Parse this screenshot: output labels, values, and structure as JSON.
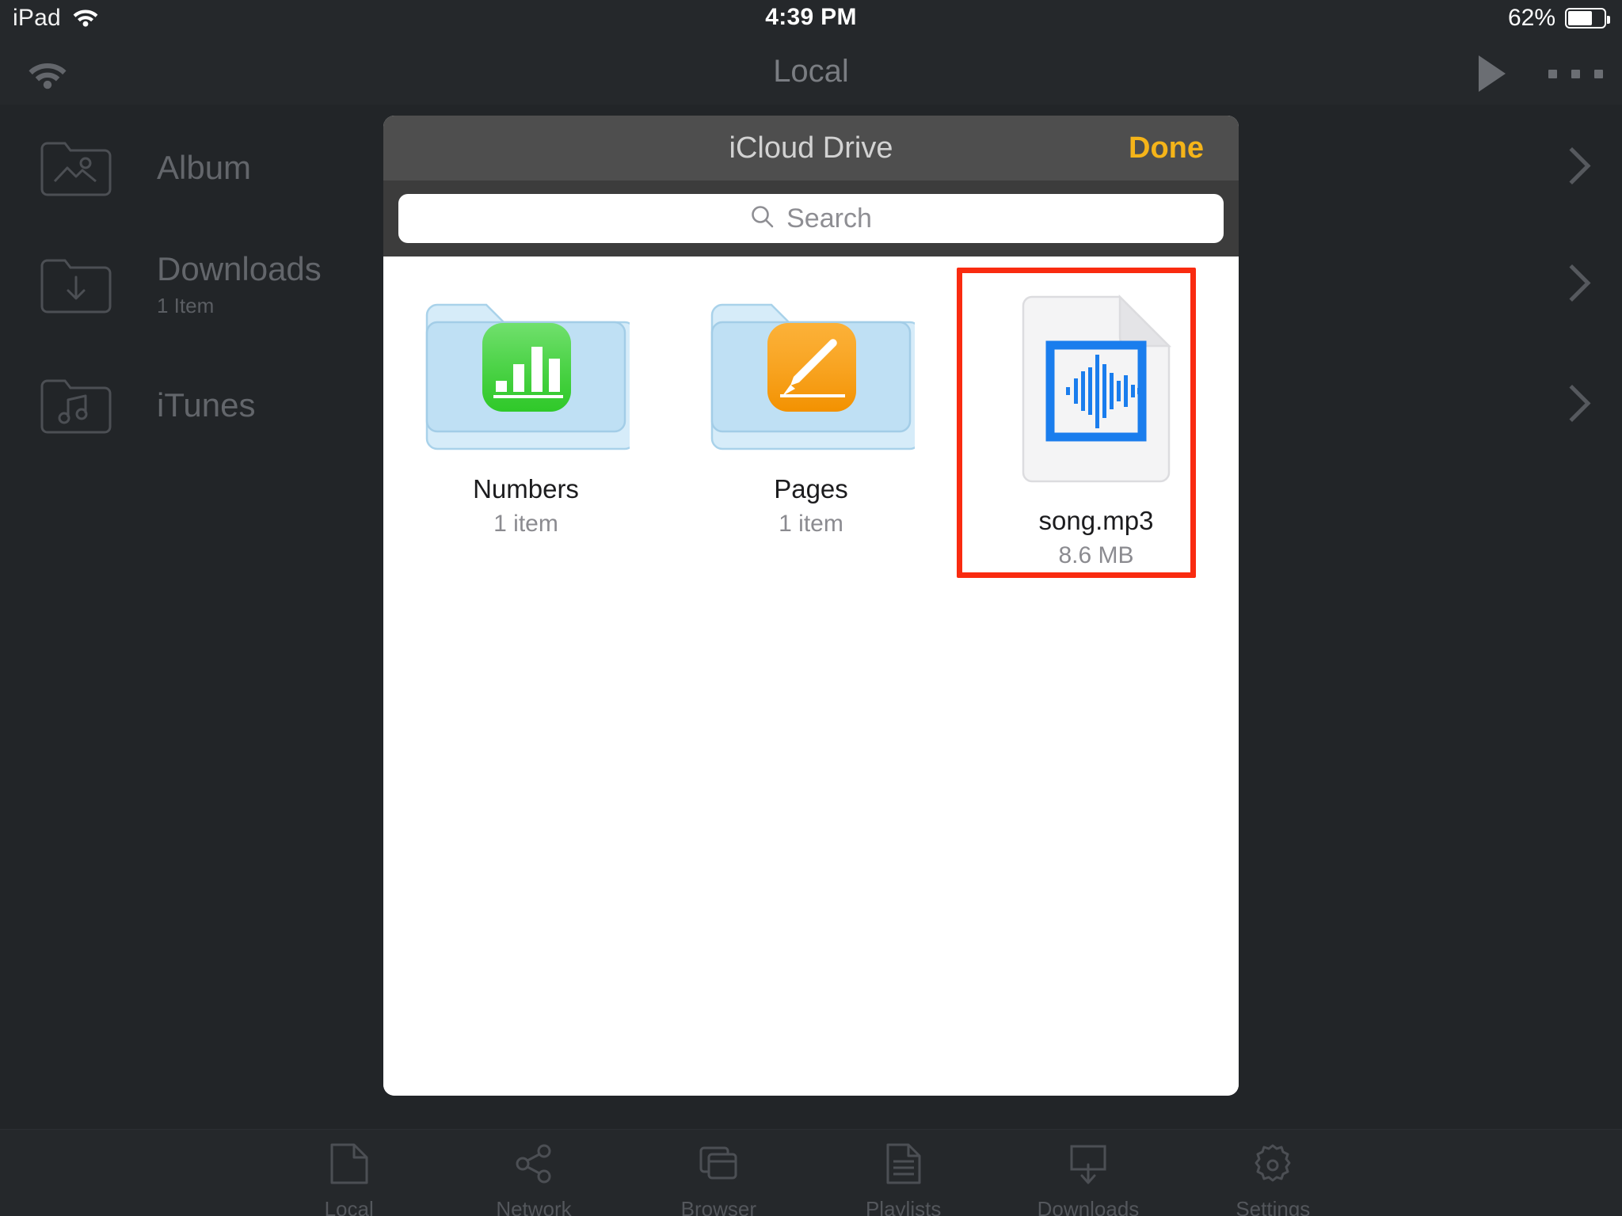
{
  "status_bar": {
    "device": "iPad",
    "wifi_icon": "wifi-icon",
    "time": "4:39 PM",
    "battery_percent": "62%",
    "battery_level": 62
  },
  "nav_bar": {
    "title": "Local",
    "wifi_icon": "wifi-icon",
    "play_icon": "play-icon",
    "more_icon": "more-ellipsis-icon"
  },
  "sidebar": {
    "items": [
      {
        "label": "Album",
        "subtitle": "",
        "icon": "folder-photo-icon",
        "chevron": "chevron-right-icon"
      },
      {
        "label": "Downloads",
        "subtitle": "1 Item",
        "icon": "folder-download-icon",
        "chevron": "chevron-right-icon"
      },
      {
        "label": "iTunes",
        "subtitle": "",
        "icon": "folder-music-icon",
        "chevron": "chevron-right-icon"
      }
    ]
  },
  "modal": {
    "title": "iCloud Drive",
    "done_label": "Done",
    "search": {
      "placeholder": "Search",
      "value": "",
      "icon": "search-icon"
    },
    "files": [
      {
        "name": "Numbers",
        "subtitle": "1 item",
        "icon": "folder-numbers-icon",
        "type": "folder"
      },
      {
        "name": "Pages",
        "subtitle": "1 item",
        "icon": "folder-pages-icon",
        "type": "folder"
      },
      {
        "name": "song.mp3",
        "subtitle": "8.6 MB",
        "icon": "audio-file-icon",
        "type": "file"
      }
    ],
    "highlighted_item": "song.mp3",
    "highlight_color": "#f92b10"
  },
  "tab_bar": {
    "items": [
      {
        "label": "Local",
        "icon": "document-icon"
      },
      {
        "label": "Network",
        "icon": "share-network-icon"
      },
      {
        "label": "Browser",
        "icon": "windows-icon"
      },
      {
        "label": "Playlists",
        "icon": "playlist-document-icon"
      },
      {
        "label": "Downloads",
        "icon": "download-tray-icon"
      },
      {
        "label": "Settings",
        "icon": "gear-icon"
      }
    ]
  },
  "colors": {
    "background": "#222528",
    "bar_background": "#25282b",
    "modal_header": "#4e4e4e",
    "accent_done": "#f5b419",
    "highlight": "#f92b10",
    "folder_blue": "#c3e1f5",
    "numbers_green": "#38d430",
    "pages_orange": "#fb9b00",
    "waveform_blue": "#1a7ded"
  }
}
